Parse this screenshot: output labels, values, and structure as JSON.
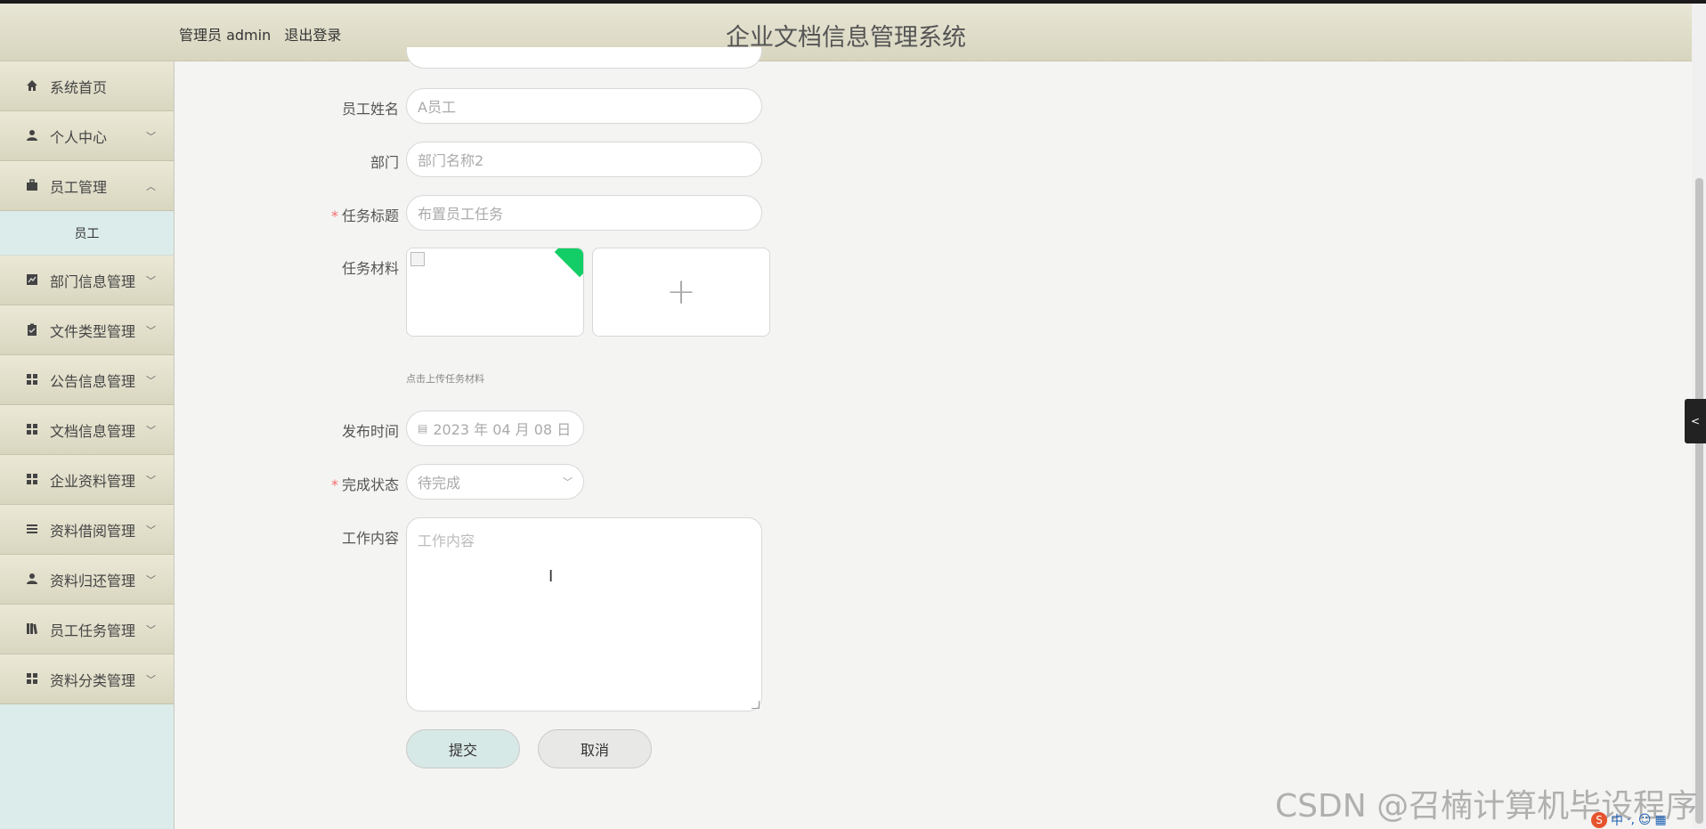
{
  "header": {
    "user_label": "管理员 admin",
    "logout_label": "退出登录",
    "title": "企业文档信息管理系统"
  },
  "sidebar": {
    "items": [
      {
        "label": "系统首页",
        "icon": "home-icon"
      },
      {
        "label": "个人中心",
        "icon": "user-icon",
        "expanded": false
      },
      {
        "label": "员工管理",
        "icon": "briefcase-icon",
        "expanded": true
      },
      {
        "label": "部门信息管理",
        "icon": "chart-icon",
        "expanded": false
      },
      {
        "label": "文件类型管理",
        "icon": "clipboard-icon",
        "expanded": false
      },
      {
        "label": "公告信息管理",
        "icon": "grid-icon",
        "expanded": false
      },
      {
        "label": "文档信息管理",
        "icon": "grid-icon",
        "expanded": false
      },
      {
        "label": "企业资料管理",
        "icon": "grid-icon",
        "expanded": false
      },
      {
        "label": "资料借阅管理",
        "icon": "list-icon",
        "expanded": false
      },
      {
        "label": "资料归还管理",
        "icon": "user-icon",
        "expanded": false
      },
      {
        "label": "员工任务管理",
        "icon": "book-icon",
        "expanded": false
      },
      {
        "label": "资料分类管理",
        "icon": "grid-icon",
        "expanded": false
      }
    ],
    "sub_item": "员工"
  },
  "form": {
    "employee_name": {
      "label": "员工姓名",
      "placeholder": "A员工"
    },
    "department": {
      "label": "部门",
      "placeholder": "部门名称2"
    },
    "task_title": {
      "label": "任务标题",
      "placeholder": "布置员工任务",
      "required_mark": "*"
    },
    "task_material": {
      "label": "任务材料",
      "hint": "点击上传任务材料"
    },
    "publish_time": {
      "label": "发布时间",
      "value": "2023 年 04 月 08 日"
    },
    "status": {
      "label": "完成状态",
      "value": "待完成",
      "required_mark": "*"
    },
    "work_content": {
      "label": "工作内容",
      "placeholder": "工作内容"
    },
    "submit_label": "提交",
    "cancel_label": "取消"
  },
  "watermark": "CSDN @召楠计算机毕设程序",
  "colors": {
    "header_bg": "#ddd9c4",
    "sidebar_sub_bg": "#dcecea",
    "submit_bg": "#d7e9e6",
    "required": "#f56c6c",
    "upload_badge": "#13ce66"
  }
}
